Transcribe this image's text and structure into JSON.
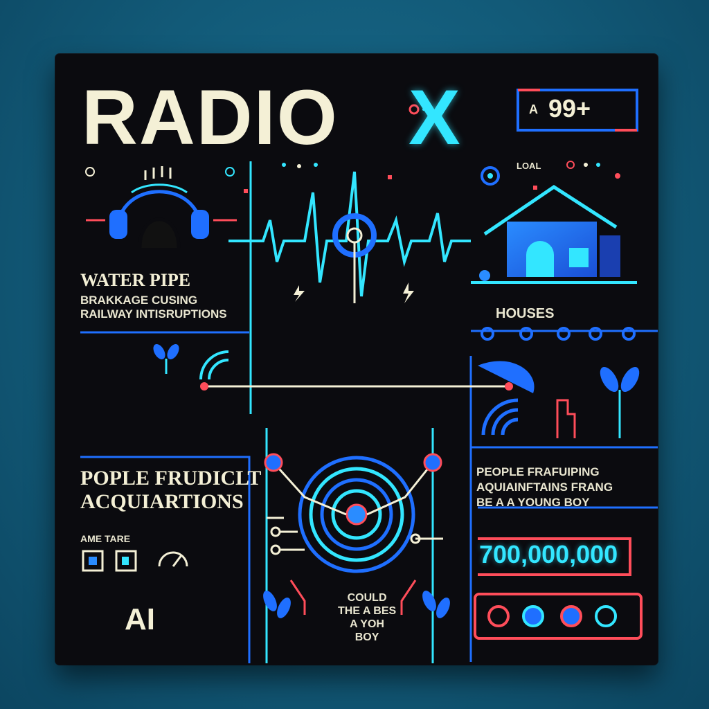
{
  "header": {
    "title_main": "RADIO",
    "title_accent": "X",
    "badge_prefix": "A",
    "badge_value": "99+",
    "top_label": "LOAL"
  },
  "left_panel": {
    "headline": "WATER PIPE",
    "line_2": "BRAKKAGE CUSING",
    "line_3": "RAILWAY INTISRUPTIONS",
    "subhead_1": "POPLE FRUDICLT",
    "subhead_2": "ACQUIARTIONS",
    "small_label": "AME TARE",
    "ai_label": "AI"
  },
  "right_panel": {
    "houses_label": "HOUSES",
    "people_line_1": "PEOPLE FRAFUIPING",
    "people_line_2": "AQUIAINFTAINS FRANG",
    "people_line_3": "BE A A YOUNG BOY",
    "big_number": "700,000,000"
  },
  "center": {
    "caption_1": "COULD",
    "caption_2": "THE A BES",
    "caption_3": "A YOH",
    "caption_4": "BOY"
  },
  "colors": {
    "cyan": "#33e6ff",
    "blue": "#1f6fff",
    "red": "#ff4d5a",
    "cream": "#f4f0d6",
    "card": "#0b0b0f",
    "background": "#125a78"
  },
  "icons": [
    "headphones-icon",
    "house-icon",
    "plant-icon",
    "signal-icon",
    "record-target-icon",
    "lightning-icon"
  ]
}
